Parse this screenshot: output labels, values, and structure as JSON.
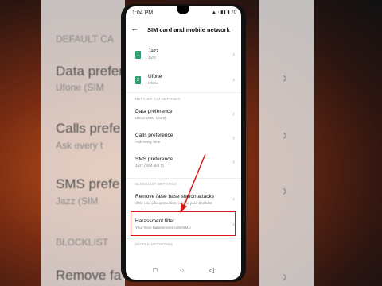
{
  "background_ghost": {
    "section1": "DEFAULT CA",
    "data": "Data prefere",
    "data_sub": "Ufone (SIM",
    "calls": "Calls prefe",
    "calls_sub": "Ask every t",
    "sms": "SMS prefe",
    "sms_sub": "Jazz (SIM",
    "section2": "BLOCKLIST",
    "remove": "Remove fa"
  },
  "status_bar": {
    "time": "1:04 PM",
    "icons": "▲ ⋅ ▮▮ ▮ 70"
  },
  "header": {
    "title": "SIM card and mobile network"
  },
  "sims": [
    {
      "icon": "1",
      "name": "Jazz",
      "sub": "Jazz"
    },
    {
      "icon": "2",
      "name": "Ufone",
      "sub": "Ufone"
    }
  ],
  "sections": {
    "default": "DEFAULT SIM SETTINGS",
    "blocklist": "BLOCKLIST SETTINGS",
    "network": "MOBILE NETWORKS"
  },
  "defaults": [
    {
      "title": "Data preference",
      "sub": "Ufone (SIM slot 2)"
    },
    {
      "title": "Calls preference",
      "sub": "Ask every time"
    },
    {
      "title": "SMS preference",
      "sub": "Jazz (SIM slot 1)"
    }
  ],
  "blocklist": [
    {
      "title": "Remove false base station attacks",
      "sub": "Only use pilot protection, add to your blocklist"
    },
    {
      "title": "Harassment filter",
      "sub": "Your from harassment calls/SMS"
    }
  ],
  "colors": {
    "highlight": "#e01515",
    "accent": "#2e9e6e"
  }
}
